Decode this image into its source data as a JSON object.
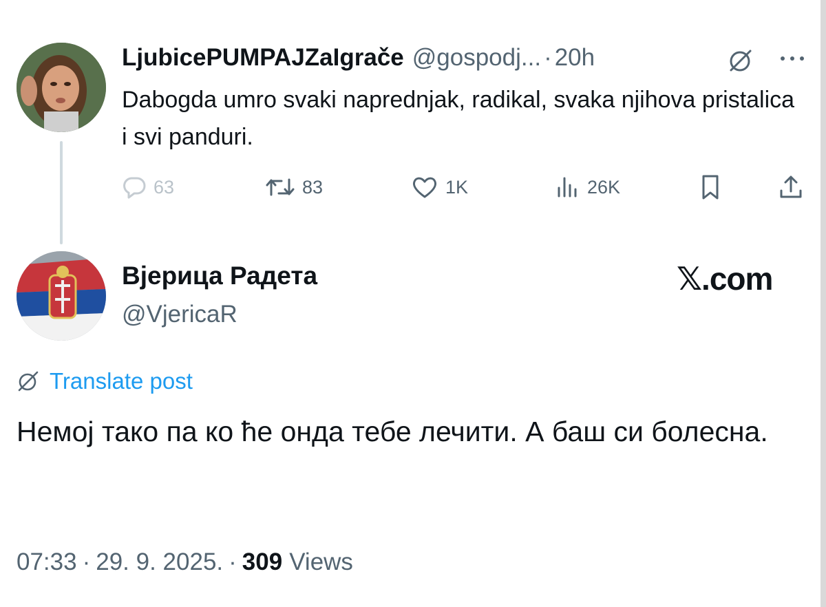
{
  "tweet1": {
    "display_name": "LjubicePUMPAJZaIgrače",
    "handle": "@gospodj...",
    "separator": "·",
    "time": "20h",
    "text": "Dabogda umro svaki naprednjak, radikal, svaka njihova pristalica i svi panduri.",
    "stats": {
      "replies": "63",
      "retweets": "83",
      "likes": "1K",
      "views": "26K"
    },
    "icons": [
      "grok-icon",
      "more-icon",
      "reply-icon",
      "retweet-icon",
      "like-icon",
      "views-icon",
      "bookmark-icon",
      "share-icon"
    ]
  },
  "tweet2": {
    "display_name": "Вјерица Радета",
    "handle": "@VjericaR",
    "brand": "𝕏.com",
    "translate_label": "Translate post",
    "text": "Немој тако па ко ће онда тебе лечити. А баш си болесна.",
    "meta": {
      "time": "07:33",
      "separator1": "·",
      "date": "29. 9. 2025.",
      "separator2": "·",
      "views_count": "309",
      "views_label": "Views"
    }
  },
  "colors": {
    "text": "#0f1419",
    "secondary": "#536471",
    "link": "#1d9bf0",
    "thread_line": "#cfd9de"
  }
}
